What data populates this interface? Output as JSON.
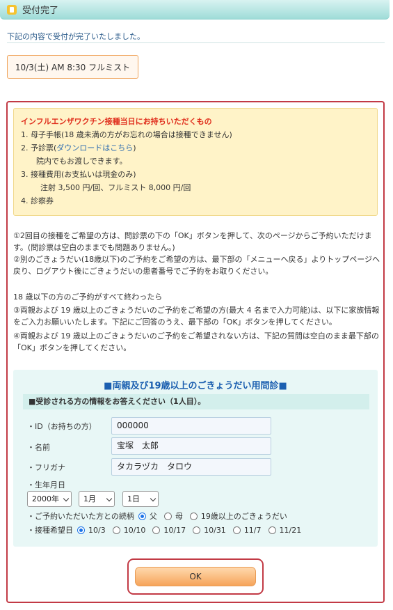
{
  "header": {
    "title": "受付完了"
  },
  "intro": "下記の内容で受付が完了いたしました。",
  "reservation": "10/3(土) AM 8:30 フルミスト",
  "notice": {
    "head": "インフルエンザワクチン接種当日にお持ちいただくもの",
    "item1": "1. 母子手帳(18 歳未満の方がお忘れの場合は接種できません)",
    "item2_prefix": "2. 予診票(",
    "item2_link": "ダウンロードはこちら",
    "item2_suffix": ")",
    "item2_sub": "院内でもお渡しできます。",
    "item3": "3. 接種費用(お支払いは現金のみ)",
    "item3_sub": "注射 3,500 円/回、フルミスト 8,000 円/回",
    "item4": "4. 診察券"
  },
  "paragraphs": {
    "p1": "①2回目の接種をご希望の方は、問診票の下の「OK」ボタンを押して、次のページからご予約いただけます。(問診票は空白のままでも問題ありません。)",
    "p2": "②別のごきょうだい(18歳以下)のご予約をご希望の方は、最下部の「メニューへ戻る」よりトップページへ戻り、ログアウト後にごきょうだいの患者番号でご予約をお取りください。",
    "p3": "18 歳以下の方のご予約がすべて終わったら",
    "p4": "③両親および 19 歳以上のごきょうだいのご予約をご希望の方(最大 4 名まで入力可能)は、以下に家族情報をご入力お願いいたします。下記にご回答のうえ、最下部の「OK」ボタンを押してください。",
    "p5": "④両親および 19 歳以上のごきょうだいのご予約をご希望されない方は、下記の質問は空白のまま最下部の「OK」ボタンを押してください。"
  },
  "form": {
    "title": "■両親及び19歳以上のごきょうだい用問診■",
    "subtitle": "■受診される方の情報をお答えください（1人目）。",
    "id_label": "・ID（お持ちの方）",
    "id_value": "000000",
    "name_label": "・名前",
    "name_value": "宝塚　太郎",
    "kana_label": "・フリガナ",
    "kana_value": "タカラヅカ　タロウ",
    "birth_label": "・生年月日",
    "birth_year": "2000年",
    "birth_month": "1月",
    "birth_day": "1日",
    "relation_label": "・ご予約いただいた方との続柄",
    "relation_options": [
      "父",
      "母",
      "19歳以上のごきょうだい"
    ],
    "date_label": "・接種希望日",
    "date_options": [
      "10/3",
      "10/10",
      "10/17",
      "10/31",
      "11/7",
      "11/21"
    ]
  },
  "ok_button": "OK"
}
